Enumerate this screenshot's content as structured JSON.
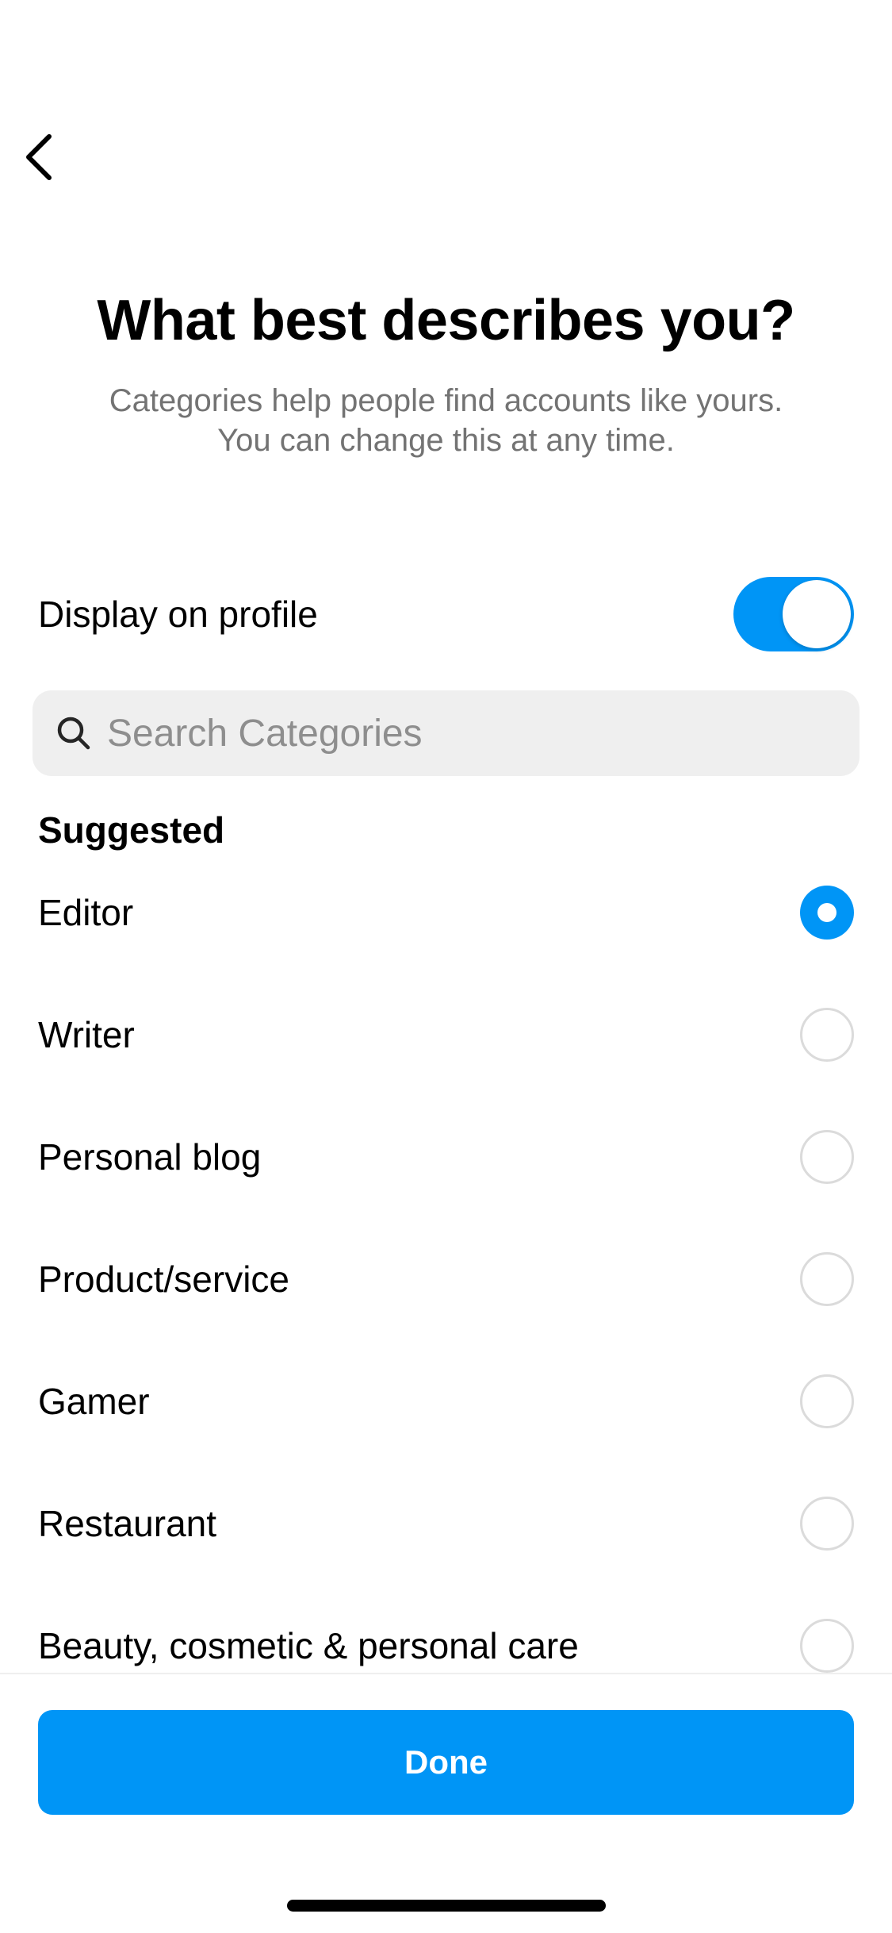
{
  "header": {
    "back_icon": "chevron-left-icon",
    "title": "What best describes you?",
    "subtitle_line1": "Categories help people find accounts like yours.",
    "subtitle_line2": "You can change this at any time."
  },
  "display_toggle": {
    "label": "Display on profile",
    "on": true
  },
  "search": {
    "icon": "search-icon",
    "placeholder": "Search Categories",
    "value": ""
  },
  "suggested": {
    "header": "Suggested",
    "items": [
      {
        "label": "Editor",
        "selected": true
      },
      {
        "label": "Writer",
        "selected": false
      },
      {
        "label": "Personal blog",
        "selected": false
      },
      {
        "label": "Product/service",
        "selected": false
      },
      {
        "label": "Gamer",
        "selected": false
      },
      {
        "label": "Restaurant",
        "selected": false
      },
      {
        "label": "Beauty, cosmetic & personal care",
        "selected": false
      }
    ]
  },
  "footer": {
    "done_label": "Done"
  },
  "colors": {
    "accent": "#0095f6",
    "secondary_text": "#737373",
    "search_bg": "#efefef",
    "radio_border": "#dbdbdb"
  }
}
